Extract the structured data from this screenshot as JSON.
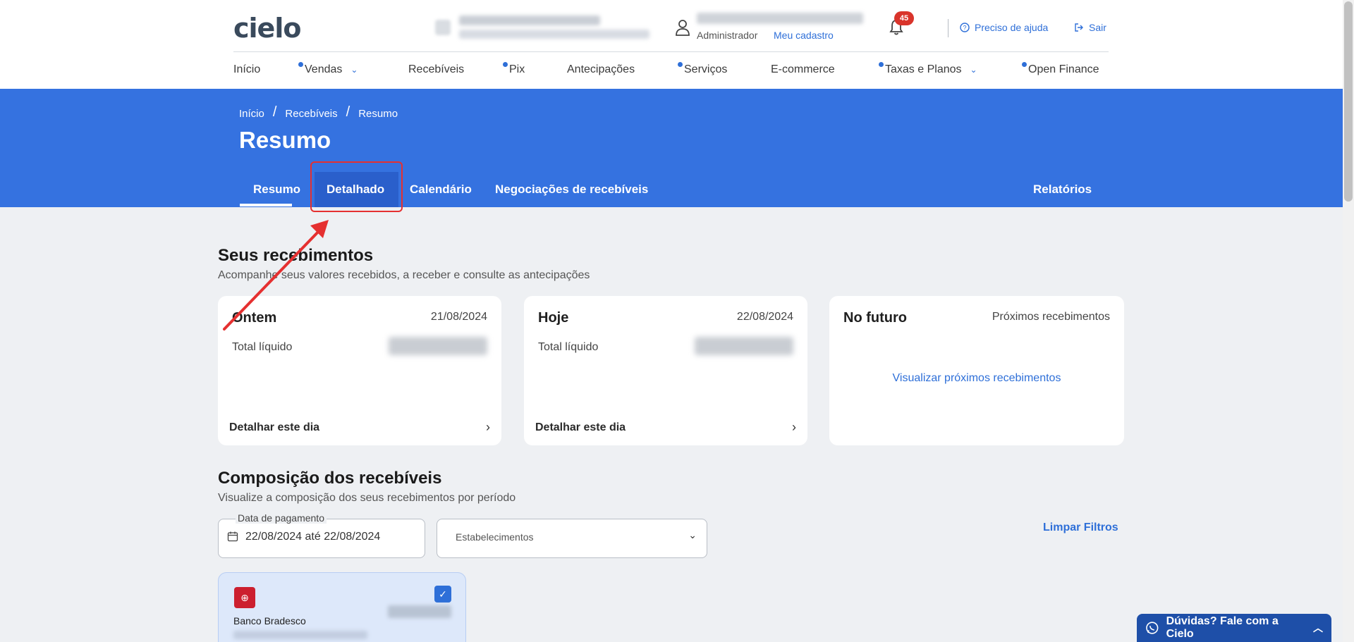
{
  "header": {
    "logo": "cielo",
    "user_role": "Administrador",
    "user_link": "Meu cadastro",
    "notifications_count": "45",
    "help_label": "Preciso de ajuda",
    "logout_label": "Sair"
  },
  "nav": {
    "items": [
      {
        "label": "Início"
      },
      {
        "label": "Vendas"
      },
      {
        "label": "Recebíveis"
      },
      {
        "label": "Pix"
      },
      {
        "label": "Antecipações"
      },
      {
        "label": "Serviços"
      },
      {
        "label": "E-commerce"
      },
      {
        "label": "Taxas e Planos"
      },
      {
        "label": "Open Finance"
      }
    ]
  },
  "breadcrumb": [
    "Início",
    "Recebíveis",
    "Resumo"
  ],
  "page_title": "Resumo",
  "tabs": {
    "resumo": "Resumo",
    "detalhado": "Detalhado",
    "calendario": "Calendário",
    "negociacoes": "Negociações de recebíveis",
    "relatorios": "Relatórios"
  },
  "recebimentos": {
    "title": "Seus recebimentos",
    "subtitle": "Acompanhe seus valores recebidos, a receber e consulte as antecipações",
    "cards": [
      {
        "title": "Ontem",
        "date": "21/08/2024",
        "total_label": "Total líquido",
        "detail_label": "Detalhar este dia"
      },
      {
        "title": "Hoje",
        "date": "22/08/2024",
        "total_label": "Total líquido",
        "detail_label": "Detalhar este dia"
      },
      {
        "title": "No futuro",
        "date": "Próximos recebimentos",
        "link_label": "Visualizar próximos recebimentos"
      }
    ]
  },
  "composicao": {
    "title": "Composição dos recebíveis",
    "subtitle": "Visualize a composição dos seus recebimentos por período",
    "date_label": "Data de pagamento",
    "date_value": "22/08/2024 até 22/08/2024",
    "estab_placeholder": "Estabelecimentos",
    "clear_label": "Limpar Filtros",
    "bank_name": "Banco Bradesco"
  },
  "chat": {
    "label": "Dúvidas? Fale com a Cielo"
  },
  "colors": {
    "brand_blue": "#3572e0",
    "link_blue": "#2e6fd8",
    "badge_red": "#d9342b",
    "annotation_red": "#e53030"
  }
}
